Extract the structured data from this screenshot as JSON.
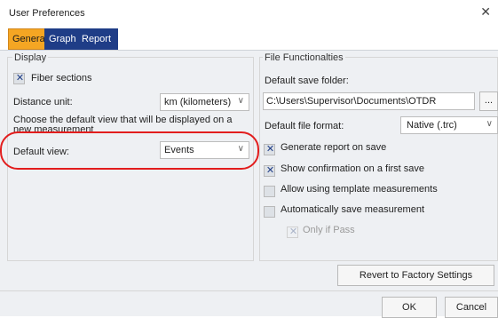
{
  "window": {
    "title": "User Preferences",
    "close_icon": "close-icon"
  },
  "tabs": [
    {
      "label": "General",
      "active": true
    },
    {
      "label": "Graph",
      "active": false
    },
    {
      "label": "Report",
      "active": false
    }
  ],
  "display": {
    "heading": "Display",
    "fiber_sections": {
      "label": "Fiber sections",
      "checked": true
    },
    "distance_unit": {
      "label": "Distance unit:",
      "value": "km (kilometers)"
    },
    "choose_text": "Choose the default view that will be displayed on a new measurement",
    "default_view": {
      "label": "Default view:",
      "value": "Events"
    }
  },
  "file_functionalities": {
    "heading": "File Functionalties",
    "save_folder_label": "Default save folder:",
    "save_folder_value": "C:\\Users\\Supervisor\\Documents\\OTDR",
    "browse_label": "...",
    "file_format_label": "Default file format:",
    "file_format_value": "Native (.trc)",
    "options": [
      {
        "label": "Generate report on save",
        "checked": true
      },
      {
        "label": "Show confirmation on a first save",
        "checked": true
      },
      {
        "label": "Allow using template measurements",
        "checked": false
      },
      {
        "label": "Automatically save measurement",
        "checked": false
      }
    ],
    "only_if_pass": {
      "label": "Only if Pass",
      "checked": true,
      "disabled": true
    }
  },
  "buttons": {
    "revert": "Revert to Factory Settings",
    "ok": "OK",
    "cancel": "Cancel"
  },
  "colors": {
    "tab_active": "#f5a623",
    "tab_inactive": "#1f3d87",
    "highlight": "#e21d1d"
  }
}
